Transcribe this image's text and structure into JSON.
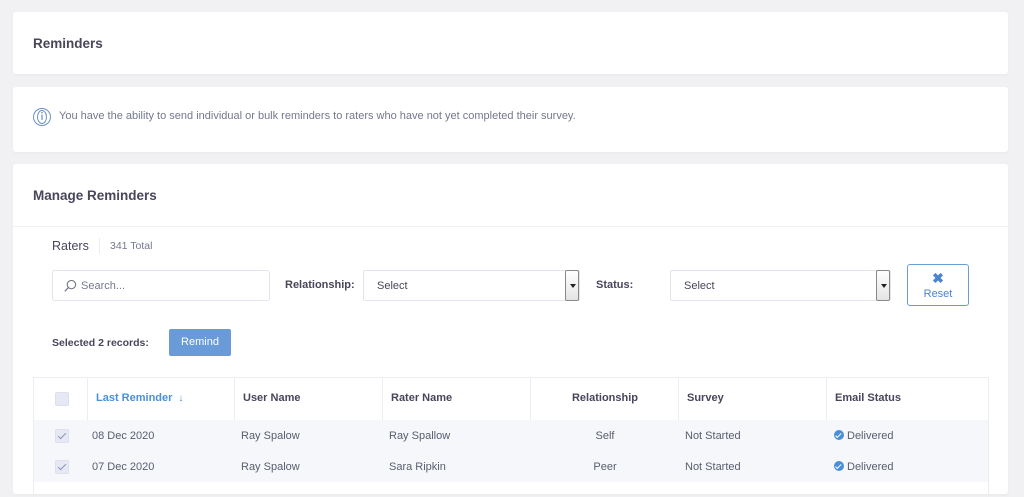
{
  "reminders_card": {
    "title": "Reminders"
  },
  "info_card": {
    "icon": "info-circle-icon",
    "text": "You have the ability to send individual or bulk reminders to raters who have not yet completed their survey."
  },
  "manage_card": {
    "title": "Manage Reminders",
    "raters_label": "Raters",
    "raters_total": "341 Total",
    "search": {
      "placeholder": "Search...",
      "value": ""
    },
    "relationship_label": "Relationship:",
    "relationship_value": "Select",
    "status_label": "Status:",
    "status_value": "Select",
    "reset_label": "Reset",
    "reset_icon": "✖",
    "selected_text": "Selected 2 records:",
    "remind_label": "Remind"
  },
  "table": {
    "columns": {
      "last_reminder": "Last Reminder",
      "user_name": "User Name",
      "rater_name": "Rater Name",
      "relationship": "Relationship",
      "survey": "Survey",
      "email_status": "Email Status"
    },
    "sort_indicator": "↓",
    "rows": [
      {
        "checked": true,
        "last_reminder": "08 Dec 2020",
        "user_name": "Ray Spalow",
        "rater_name": "Ray Spallow",
        "relationship": "Self",
        "survey": "Not Started",
        "email_status": "Delivered"
      },
      {
        "checked": true,
        "last_reminder": "07 Dec 2020",
        "user_name": "Ray Spalow",
        "rater_name": "Sara Ripkin",
        "relationship": "Peer",
        "survey": "Not Started",
        "email_status": "Delivered"
      }
    ]
  },
  "colors": {
    "page_bg": "#f1f1f3",
    "accent": "#4a90d9",
    "button_primary": "#6a9bd9",
    "row_bg": "#f6f7fb"
  }
}
